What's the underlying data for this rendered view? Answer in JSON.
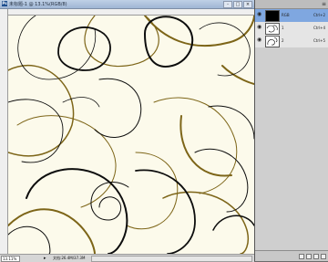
{
  "document": {
    "title": "未标题-1 @ 13.1%(RGB/8)",
    "icon": "ps-doc-icon",
    "buttons": {
      "minimize": "-",
      "maximize": "□",
      "close": "×"
    }
  },
  "statusbar": {
    "zoom": "13.11%",
    "arrow": "▸",
    "doc_info": "文档:26.4M/37.3M"
  },
  "layers": {
    "items": [
      {
        "name": "RGB",
        "shortcut": "Ctrl+2",
        "selected": true,
        "thumb": "black"
      },
      {
        "name": "1",
        "shortcut": "Ctrl+4",
        "selected": false,
        "thumb": "pattern"
      },
      {
        "name": "2",
        "shortcut": "Ctrl+5",
        "selected": false,
        "thumb": "pattern"
      }
    ],
    "menu_icon": "≡",
    "bottom_icons": [
      "new-channel-icon",
      "mask-icon",
      "new-layer-icon",
      "trash-icon"
    ]
  },
  "colors": {
    "canvas_bg": "#fcfaeb",
    "line_black": "#0d0d0d",
    "line_brown": "#7d6518",
    "selection": "#7fa7e0"
  }
}
